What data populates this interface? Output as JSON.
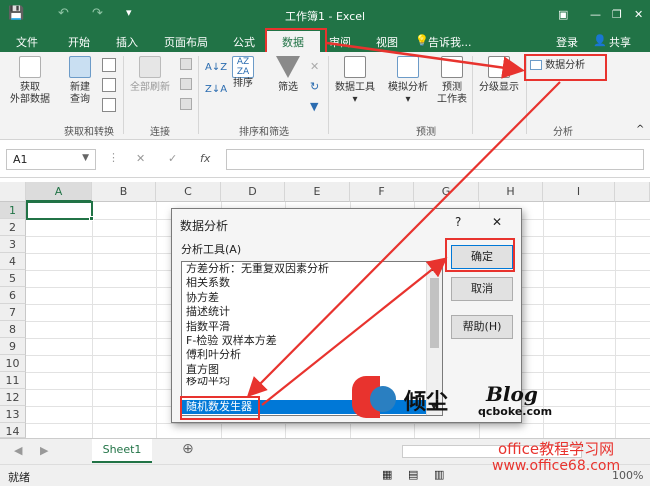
{
  "window": {
    "title": "工作簿1 - Excel",
    "quick_access": [
      "save-icon",
      "undo-icon",
      "redo-icon",
      "customize-icon"
    ]
  },
  "tabs": [
    {
      "label": "文件"
    },
    {
      "label": "开始"
    },
    {
      "label": "插入"
    },
    {
      "label": "页面布局"
    },
    {
      "label": "公式"
    },
    {
      "label": "数据"
    },
    {
      "label": "审阅"
    },
    {
      "label": "视图"
    },
    {
      "label": "告诉我..."
    }
  ],
  "account": {
    "login": "登录",
    "share": "共享"
  },
  "ribbon": {
    "get_external": "获取\n外部数据",
    "new_query": "新建\n查询",
    "refresh_all": "全部刷新",
    "sort": "排序",
    "filter": "筛选",
    "data_tools": "数据工具",
    "what_if": "模拟分析",
    "forecast_sheet": "预测\n工作表",
    "outline": "分级显示",
    "data_analysis": "数据分析",
    "groups": {
      "get_transform": "获取和转换",
      "connections": "连接",
      "sort_filter": "排序和筛选",
      "forecast": "预测",
      "analysis": "分析"
    }
  },
  "formula_bar": {
    "name_box": "A1",
    "fx": "fx",
    "value": ""
  },
  "grid": {
    "columns": [
      "A",
      "B",
      "C",
      "D",
      "E",
      "F",
      "G",
      "H",
      "I"
    ],
    "rows": [
      "1",
      "2",
      "3",
      "4",
      "5",
      "6",
      "7",
      "8",
      "9",
      "10",
      "11",
      "12",
      "13",
      "14"
    ]
  },
  "dialog": {
    "title": "数据分析",
    "help": "?",
    "close": "✕",
    "list_label": "分析工具(A)",
    "items": [
      "方差分析：无重复双因素分析",
      "相关系数",
      "协方差",
      "描述统计",
      "指数平滑",
      "F-检验 双样本方差",
      "傅利叶分析",
      "直方图",
      "移动平均",
      "随机数发生器"
    ],
    "selected_index": 9,
    "buttons": {
      "ok": "确定",
      "cancel": "取消",
      "help": "帮助(H)"
    }
  },
  "sheet_tabs": [
    {
      "label": "Sheet1"
    }
  ],
  "status": {
    "ready": "就绪",
    "zoom": "100%"
  },
  "watermark": {
    "brand": "倾尘",
    "blog": "Blog",
    "domain": "qcboke.com",
    "site_name": "office教程学习网",
    "site_url": "www.office68.com"
  },
  "colors": {
    "excel_green": "#217346",
    "highlight_red": "#e8332e",
    "selection_blue": "#0078d7"
  }
}
